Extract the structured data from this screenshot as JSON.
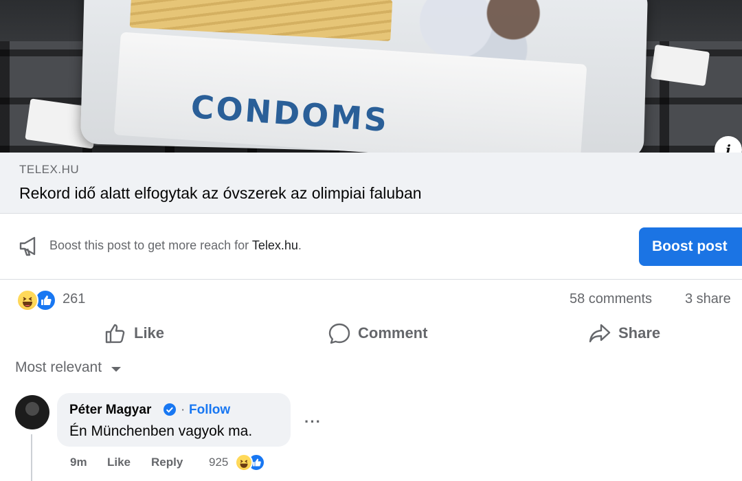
{
  "hero": {
    "box_label": "CONDOMS",
    "info_label": "i"
  },
  "link_preview": {
    "domain": "TELEX.HU",
    "title": "Rekord idő alatt elfogytak az óvszerek az olimpiai faluban"
  },
  "boost": {
    "prompt": "Boost this post to get more reach for",
    "page_name": "Telex.hu",
    "prompt_end": ".",
    "button_label": "Boost post",
    "button_color": "#1b74e4"
  },
  "reactions": {
    "icons": [
      "haha-emoji",
      "like-emoji"
    ],
    "count": "261",
    "comments": "58 comments",
    "shares": "3 share"
  },
  "actions": {
    "like": "Like",
    "comment": "Comment",
    "share": "Share"
  },
  "comments_section": {
    "sort_label": "Most relevant",
    "comment": {
      "author": "Péter Magyar",
      "verified": true,
      "separator": "·",
      "follow_label": "Follow",
      "text": "Én Münchenben vagyok ma.",
      "time": "9m",
      "like_label": "Like",
      "reply_label": "Reply",
      "reaction_count": "925",
      "reaction_icons": [
        "haha-emoji",
        "like-emoji"
      ]
    }
  },
  "colors": {
    "link_blue": "#1877f2",
    "secondary_text": "#65676b",
    "preview_bg": "#f0f2f5"
  }
}
